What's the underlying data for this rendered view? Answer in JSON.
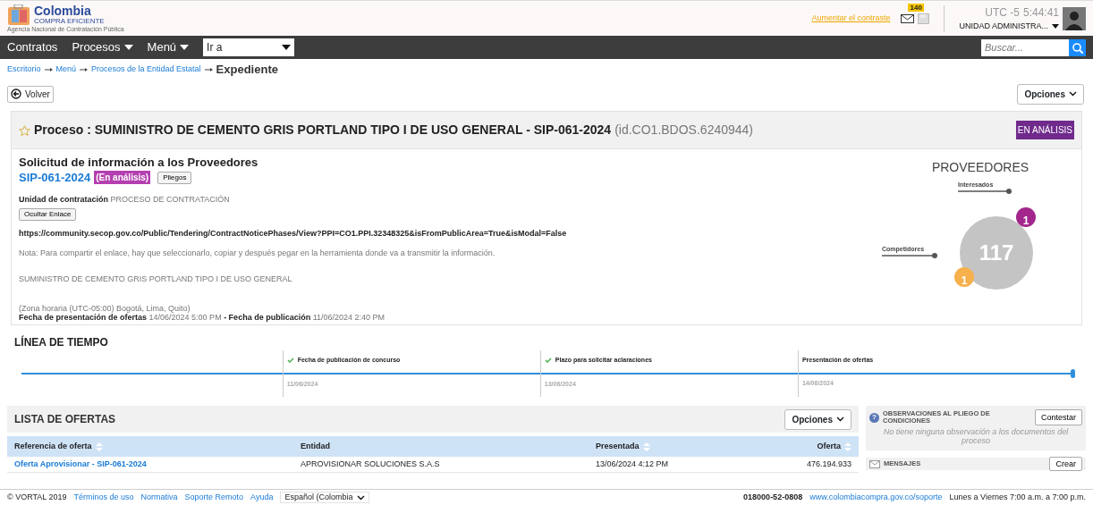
{
  "header": {
    "logo": {
      "name": "Colombia",
      "tagline": "COMPRA EFICIENTE",
      "agency": "Agencia Nacional de Contratación Pública"
    },
    "contrast_link": "Aumentar el contraste",
    "mail_count": "140",
    "timezone": "UTC -5",
    "time": "5:44:41",
    "user": "UNIDAD ADMINISTRA..."
  },
  "nav": {
    "items": [
      {
        "label": "Contratos",
        "dropdown": false
      },
      {
        "label": "Procesos",
        "dropdown": true
      },
      {
        "label": "Menú",
        "dropdown": true
      }
    ],
    "goto": "Ir a",
    "search": {
      "placeholder": "Buscar..."
    }
  },
  "breadcrumb": {
    "links": [
      "Escritorio",
      "Menú",
      "Procesos de la Entidad Estatal"
    ],
    "current": "Expediente"
  },
  "back_button": "Volver",
  "options_button": "Opciones",
  "process": {
    "title": "Proceso : SUMINISTRO DE CEMENTO GRIS PORTLAND TIPO I DE USO GENERAL - SIP-061-2024",
    "id": "(id.CO1.BDOS.6240944)",
    "favorite": false,
    "status": "EN ANÁLISIS",
    "heading": "Solicitud de información a los Proveedores",
    "reference": "SIP-061-2024",
    "state_tag": "(En análisis)",
    "pliegos": "Pliegos",
    "unit_label": "Unidad de contratación",
    "unit": "PROCESO DE CONTRATACIÓN",
    "hide_link": "Ocultar Enlace",
    "url": "https://community.secop.gov.co/Public/Tendering/ContractNoticePhases/View?PPI=CO1.PPI.32348325&isFromPublicArea=True&isModal=False",
    "note": "Nota: Para compartir el enlace, hay que seleccionarlo, copiar y después pegar en la herramienta donde va a transmitir la información.",
    "description": "SUMINISTRO DE CEMENTO GRIS PORTLAND TIPO I DE USO GENERAL",
    "timezone": "(Zona horaria (UTC-05:00) Bogotá, Lima, Quito)",
    "dates_separator": "-",
    "dates": [
      {
        "label": "Fecha de presentación de ofertas",
        "value": "14/06/2024 5:00 PM"
      },
      {
        "label": "Fecha de publicación",
        "value": "11/06/2024 2:40 PM"
      }
    ],
    "providers": {
      "title": "PROVEEDORES",
      "total": "117",
      "groups": [
        {
          "label": "Interesados",
          "count": "1",
          "color": "#a3268c"
        },
        {
          "label": "Competidores",
          "count": "1",
          "color": "#f6b04c"
        }
      ]
    }
  },
  "timeline": {
    "title": "LÍNEA DE TIEMPO",
    "level": 1,
    "milestones": [
      {
        "label": "Fecha de publicación de concurso",
        "date": "11/06/2024",
        "done": true
      },
      {
        "label": "Plazo para solicitar aclaraciones",
        "date": "13/06/2024",
        "done": true
      },
      {
        "label": "Presentación de ofertas",
        "date": "14/06/2024",
        "done": false
      }
    ]
  },
  "offers": {
    "title": "LISTA DE OFERTAS",
    "options": "Opciones",
    "columns": [
      {
        "label": "Referencia de oferta",
        "sortable": true
      },
      {
        "label": "Entidad",
        "sortable": false
      },
      {
        "label": "Presentada",
        "sortable": true
      },
      {
        "label": "Oferta",
        "sortable": true
      }
    ],
    "rows": [
      [
        "Oferta Aprovisionar - SIP-061-2024",
        "APROVISIONAR SOLUCIONES S.A.S",
        "13/06/2024 4:12 PM",
        "476.194.933"
      ]
    ]
  },
  "observations": {
    "help_icon": "?",
    "title": "OBSERVACIONES AL PLIEGO DE CONDICIONES",
    "button": "Contestar",
    "empty": "No tiene ninguna observación a los documentos del proceso"
  },
  "messages": {
    "title": "MENSAJES",
    "button": "Crear"
  },
  "footer": {
    "copyright": "© VORTAL 2019",
    "links": [
      "Términos de uso",
      "Normativa",
      "Soporte Remoto",
      "Ayuda"
    ],
    "language": "Español (Colombia",
    "phone": "018000-52-0808",
    "site": "www.colombiacompra.gov.co/soporte",
    "hours": "Lunes a Viernes 7:00 a.m. a 7:00 p.m."
  }
}
